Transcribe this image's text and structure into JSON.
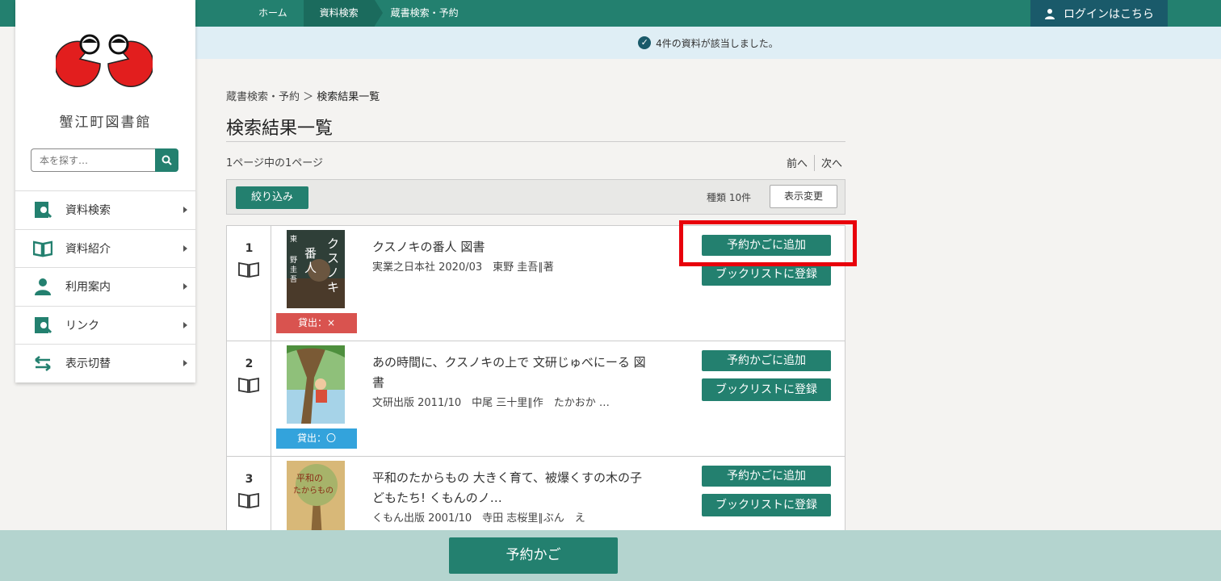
{
  "topbar": {
    "crumbs": [
      "ホーム",
      "資料検索",
      "蔵書検索・予約"
    ],
    "login_label": "ログインはこちら"
  },
  "notice": {
    "text": "4件の資料が該当しました。"
  },
  "sidebar": {
    "library_name": "蟹江町図書館",
    "search_placeholder": "本を探す…",
    "menu": [
      {
        "label": "資料検索",
        "icon": "magnifier-doc-icon"
      },
      {
        "label": "資料紹介",
        "icon": "open-book-icon"
      },
      {
        "label": "利用案内",
        "icon": "person-icon"
      },
      {
        "label": "リンク",
        "icon": "magnifier-doc-icon"
      },
      {
        "label": "表示切替",
        "icon": "swap-arrows-icon"
      }
    ]
  },
  "main": {
    "breadcrumb_prefix": "蔵書検索・予約 ＞ ",
    "breadcrumb_current": "検索結果一覧",
    "title": "検索結果一覧",
    "page_info": "1ページ中の1ページ",
    "prev_label": "前へ",
    "next_label": "次へ",
    "filter_label": "絞り込み",
    "kind_label": "種類 10件",
    "view_change_label": "表示変更"
  },
  "results": [
    {
      "num": "1",
      "title": "クスノキの番人 図書",
      "meta": "実業之日本社 2020/03　東野 圭吾∥著",
      "status": "貸出：×",
      "reserve_label": "予約かごに追加",
      "booklist_label": "ブックリストに登録"
    },
    {
      "num": "2",
      "title": "あの時間に、クスノキの上で 文研じゅべにーる 図書",
      "meta": "文研出版 2011/10　中尾 三十里∥作　たかおか …",
      "status": "貸出：〇",
      "reserve_label": "予約かごに追加",
      "booklist_label": "ブックリストに登録"
    },
    {
      "num": "3",
      "title": "平和のたからもの 大きく育て、被爆くすの木の子どもたち! くもんのノ…",
      "meta": "くもん出版 2001/10　寺田 志桜里∥ぶん　え",
      "status": "",
      "reserve_label": "予約かごに追加",
      "booklist_label": "ブックリストに登録"
    }
  ],
  "footer": {
    "cart_label": "予約かご"
  },
  "colors": {
    "accent": "#23806f",
    "highlight": "#e8000b",
    "out": "#d9534f",
    "in": "#33a3dc"
  }
}
